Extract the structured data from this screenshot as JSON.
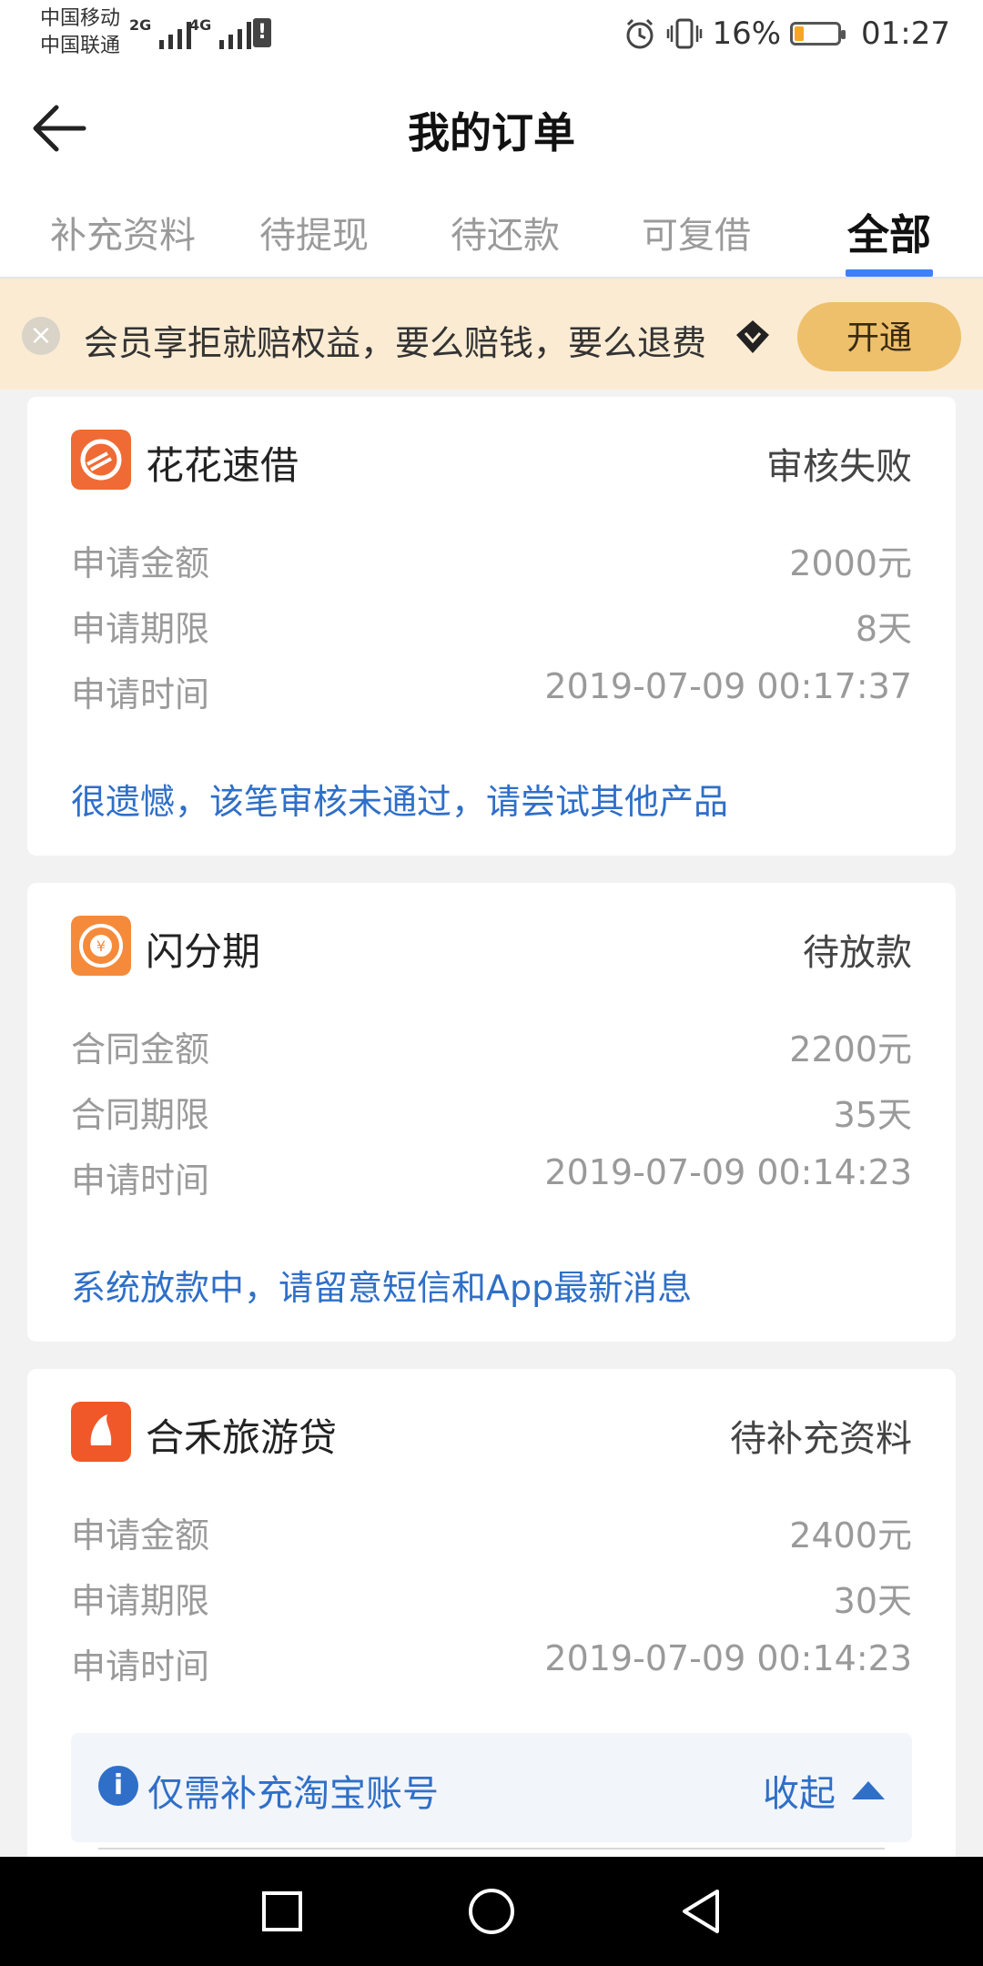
{
  "status_bar": {
    "carrier_1": "中国移动",
    "carrier_2": "中国联通",
    "network_1": "2G",
    "network_2": "4G",
    "battery": "16%",
    "time": "01:27"
  },
  "header": {
    "title": "我的订单"
  },
  "tabs": [
    {
      "label": "补充资料"
    },
    {
      "label": "待提现"
    },
    {
      "label": "待还款"
    },
    {
      "label": "可复借"
    },
    {
      "label": "全部"
    }
  ],
  "banner": {
    "text": "会员享拒就赔权益，要么赔钱，要么退费",
    "button": "开通"
  },
  "orders": [
    {
      "name": "花花速借",
      "status": "审核失败",
      "rows": [
        {
          "k": "申请金额",
          "v": "2000元"
        },
        {
          "k": "申请期限",
          "v": "8天"
        },
        {
          "k": "申请时间",
          "v": "2019-07-09 00:17:37"
        }
      ],
      "note": "很遗憾，该笔审核未通过，请尝试其他产品"
    },
    {
      "name": "闪分期",
      "status": "待放款",
      "rows": [
        {
          "k": "合同金额",
          "v": "2200元"
        },
        {
          "k": "合同期限",
          "v": "35天"
        },
        {
          "k": "申请时间",
          "v": "2019-07-09 00:14:23"
        }
      ],
      "note": "系统放款中，请留意短信和App最新消息"
    },
    {
      "name": "合禾旅游贷",
      "status": "待补充资料",
      "rows": [
        {
          "k": "申请金额",
          "v": "2400元"
        },
        {
          "k": "申请期限",
          "v": "30天"
        },
        {
          "k": "申请时间",
          "v": "2019-07-09 00:14:23"
        }
      ],
      "note": "仅需补充淘宝账号",
      "collapse": "收起"
    }
  ],
  "colors": {
    "accent": "#3b82f6",
    "link": "#2f6fc8",
    "banner_bg": "#fbebd3",
    "banner_button": "#eec06b"
  }
}
